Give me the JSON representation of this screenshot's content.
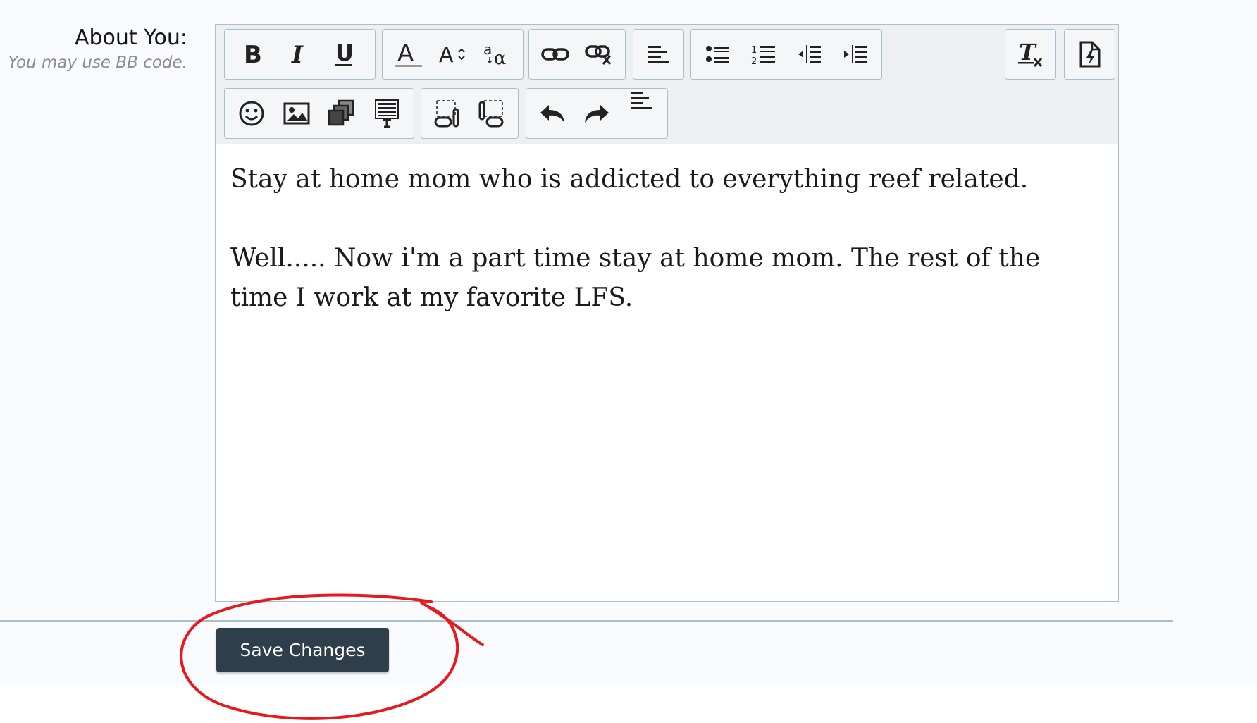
{
  "field": {
    "label": "About You:",
    "hint": "You may use BB code."
  },
  "toolbar": {
    "rows": [
      [
        {
          "group": "text-style",
          "buttons": [
            "bold-icon",
            "italic-icon",
            "underline-icon"
          ]
        },
        {
          "group": "font",
          "buttons": [
            "text-color-icon",
            "font-size-icon",
            "font-family-icon"
          ]
        },
        {
          "group": "links",
          "buttons": [
            "link-icon",
            "unlink-icon"
          ]
        },
        {
          "group": "align",
          "buttons": [
            "align-left-icon"
          ]
        },
        {
          "group": "lists",
          "buttons": [
            "bullet-list-icon",
            "numbered-list-icon",
            "outdent-icon",
            "indent-icon"
          ]
        },
        {
          "group": "format",
          "buttons": [
            "remove-format-icon"
          ]
        },
        {
          "group": "mode",
          "buttons": [
            "toggle-source-icon"
          ]
        }
      ],
      [
        {
          "group": "insert",
          "buttons": [
            "smilie-icon",
            "image-icon",
            "media-icon",
            "code-icon"
          ]
        },
        {
          "group": "drafts",
          "buttons": [
            "save-draft-icon",
            "delete-draft-icon"
          ]
        },
        {
          "group": "history",
          "buttons": [
            "undo-icon",
            "redo-icon",
            "align-left-icon"
          ]
        }
      ]
    ]
  },
  "editor": {
    "paragraphs": [
      "Stay at home mom who is addicted to everything reef related.",
      "Well..... Now i'm a part time stay at home mom. The rest of the time I work at my favorite LFS."
    ]
  },
  "actions": {
    "save_label": "Save Changes"
  },
  "annotation": {
    "color": "#e8191c",
    "shape": "circle-around-save-button"
  }
}
